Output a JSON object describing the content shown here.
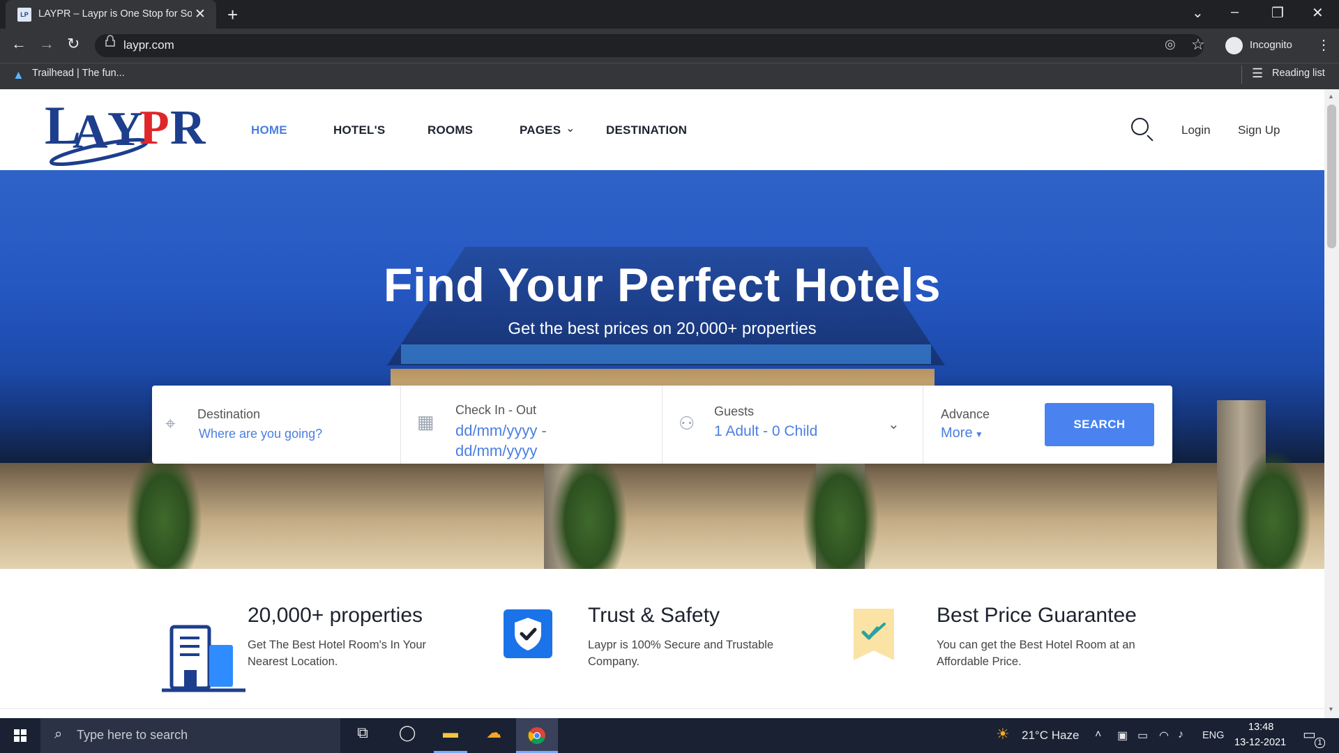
{
  "browser": {
    "tab_title": "LAYPR – Laypr is One Stop for So",
    "url": "laypr.com",
    "incognito_label": "Incognito",
    "bookmark_label": "Trailhead | The fun...",
    "reading_list_label": "Reading list"
  },
  "site": {
    "logo_text": "LAYPR",
    "nav": {
      "home": "HOME",
      "hotels": "HOTEL'S",
      "rooms": "ROOMS",
      "pages": "PAGES",
      "destination": "DESTINATION"
    },
    "login": "Login",
    "signup": "Sign Up",
    "accent_color": "#4a7fe0"
  },
  "hero": {
    "title": "Find Your Perfect Hotels",
    "subtitle": "Get the best prices on 20,000+ properties"
  },
  "search_form": {
    "destination_label": "Destination",
    "destination_placeholder": "Where are you going?",
    "checkin_label": "Check In - Out",
    "checkin_value_line1": "dd/mm/yyyy -",
    "checkin_value_line2": "dd/mm/yyyy",
    "guests_label": "Guests",
    "guests_value": "1 Adult - 0 Child",
    "advance_label": "Advance",
    "more_label": "More",
    "search_button": "SEARCH"
  },
  "features": [
    {
      "title": "20,000+ properties",
      "line1": "Get The Best Hotel Room's In Your",
      "line2": "Nearest Location.",
      "icon": "building-icon"
    },
    {
      "title": "Trust & Safety",
      "line1": "Laypr is 100% Secure and Trustable",
      "line2": "Company.",
      "icon": "shield-check-icon"
    },
    {
      "title": "Best Price Guarantee",
      "line1": "You can get the Best Hotel Room at an",
      "line2": "Affordable Price.",
      "icon": "price-tag-icon"
    }
  ],
  "taskbar": {
    "search_placeholder": "Type here to search",
    "weather": "21°C  Haze",
    "language": "ENG",
    "time": "13:48",
    "date": "13-12-2021",
    "notification_count": "1"
  }
}
